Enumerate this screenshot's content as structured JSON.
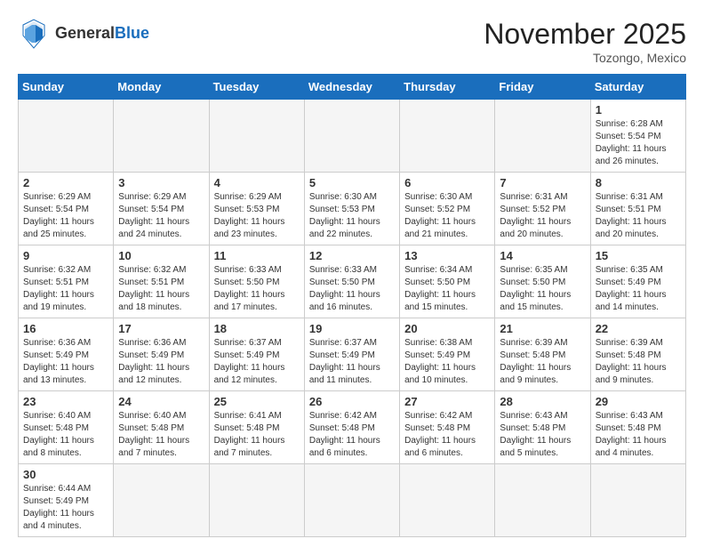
{
  "header": {
    "logo_general": "General",
    "logo_blue": "Blue",
    "month_title": "November 2025",
    "location": "Tozongo, Mexico"
  },
  "weekdays": [
    "Sunday",
    "Monday",
    "Tuesday",
    "Wednesday",
    "Thursday",
    "Friday",
    "Saturday"
  ],
  "weeks": [
    [
      {
        "day": "",
        "content": ""
      },
      {
        "day": "",
        "content": ""
      },
      {
        "day": "",
        "content": ""
      },
      {
        "day": "",
        "content": ""
      },
      {
        "day": "",
        "content": ""
      },
      {
        "day": "",
        "content": ""
      },
      {
        "day": "1",
        "content": "Sunrise: 6:28 AM\nSunset: 5:54 PM\nDaylight: 11 hours and 26 minutes."
      }
    ],
    [
      {
        "day": "2",
        "content": "Sunrise: 6:29 AM\nSunset: 5:54 PM\nDaylight: 11 hours and 25 minutes."
      },
      {
        "day": "3",
        "content": "Sunrise: 6:29 AM\nSunset: 5:54 PM\nDaylight: 11 hours and 24 minutes."
      },
      {
        "day": "4",
        "content": "Sunrise: 6:29 AM\nSunset: 5:53 PM\nDaylight: 11 hours and 23 minutes."
      },
      {
        "day": "5",
        "content": "Sunrise: 6:30 AM\nSunset: 5:53 PM\nDaylight: 11 hours and 22 minutes."
      },
      {
        "day": "6",
        "content": "Sunrise: 6:30 AM\nSunset: 5:52 PM\nDaylight: 11 hours and 21 minutes."
      },
      {
        "day": "7",
        "content": "Sunrise: 6:31 AM\nSunset: 5:52 PM\nDaylight: 11 hours and 20 minutes."
      },
      {
        "day": "8",
        "content": "Sunrise: 6:31 AM\nSunset: 5:51 PM\nDaylight: 11 hours and 20 minutes."
      }
    ],
    [
      {
        "day": "9",
        "content": "Sunrise: 6:32 AM\nSunset: 5:51 PM\nDaylight: 11 hours and 19 minutes."
      },
      {
        "day": "10",
        "content": "Sunrise: 6:32 AM\nSunset: 5:51 PM\nDaylight: 11 hours and 18 minutes."
      },
      {
        "day": "11",
        "content": "Sunrise: 6:33 AM\nSunset: 5:50 PM\nDaylight: 11 hours and 17 minutes."
      },
      {
        "day": "12",
        "content": "Sunrise: 6:33 AM\nSunset: 5:50 PM\nDaylight: 11 hours and 16 minutes."
      },
      {
        "day": "13",
        "content": "Sunrise: 6:34 AM\nSunset: 5:50 PM\nDaylight: 11 hours and 15 minutes."
      },
      {
        "day": "14",
        "content": "Sunrise: 6:35 AM\nSunset: 5:50 PM\nDaylight: 11 hours and 15 minutes."
      },
      {
        "day": "15",
        "content": "Sunrise: 6:35 AM\nSunset: 5:49 PM\nDaylight: 11 hours and 14 minutes."
      }
    ],
    [
      {
        "day": "16",
        "content": "Sunrise: 6:36 AM\nSunset: 5:49 PM\nDaylight: 11 hours and 13 minutes."
      },
      {
        "day": "17",
        "content": "Sunrise: 6:36 AM\nSunset: 5:49 PM\nDaylight: 11 hours and 12 minutes."
      },
      {
        "day": "18",
        "content": "Sunrise: 6:37 AM\nSunset: 5:49 PM\nDaylight: 11 hours and 12 minutes."
      },
      {
        "day": "19",
        "content": "Sunrise: 6:37 AM\nSunset: 5:49 PM\nDaylight: 11 hours and 11 minutes."
      },
      {
        "day": "20",
        "content": "Sunrise: 6:38 AM\nSunset: 5:49 PM\nDaylight: 11 hours and 10 minutes."
      },
      {
        "day": "21",
        "content": "Sunrise: 6:39 AM\nSunset: 5:48 PM\nDaylight: 11 hours and 9 minutes."
      },
      {
        "day": "22",
        "content": "Sunrise: 6:39 AM\nSunset: 5:48 PM\nDaylight: 11 hours and 9 minutes."
      }
    ],
    [
      {
        "day": "23",
        "content": "Sunrise: 6:40 AM\nSunset: 5:48 PM\nDaylight: 11 hours and 8 minutes."
      },
      {
        "day": "24",
        "content": "Sunrise: 6:40 AM\nSunset: 5:48 PM\nDaylight: 11 hours and 7 minutes."
      },
      {
        "day": "25",
        "content": "Sunrise: 6:41 AM\nSunset: 5:48 PM\nDaylight: 11 hours and 7 minutes."
      },
      {
        "day": "26",
        "content": "Sunrise: 6:42 AM\nSunset: 5:48 PM\nDaylight: 11 hours and 6 minutes."
      },
      {
        "day": "27",
        "content": "Sunrise: 6:42 AM\nSunset: 5:48 PM\nDaylight: 11 hours and 6 minutes."
      },
      {
        "day": "28",
        "content": "Sunrise: 6:43 AM\nSunset: 5:48 PM\nDaylight: 11 hours and 5 minutes."
      },
      {
        "day": "29",
        "content": "Sunrise: 6:43 AM\nSunset: 5:48 PM\nDaylight: 11 hours and 4 minutes."
      }
    ],
    [
      {
        "day": "30",
        "content": "Sunrise: 6:44 AM\nSunset: 5:49 PM\nDaylight: 11 hours and 4 minutes."
      },
      {
        "day": "",
        "content": ""
      },
      {
        "day": "",
        "content": ""
      },
      {
        "day": "",
        "content": ""
      },
      {
        "day": "",
        "content": ""
      },
      {
        "day": "",
        "content": ""
      },
      {
        "day": "",
        "content": ""
      }
    ]
  ]
}
